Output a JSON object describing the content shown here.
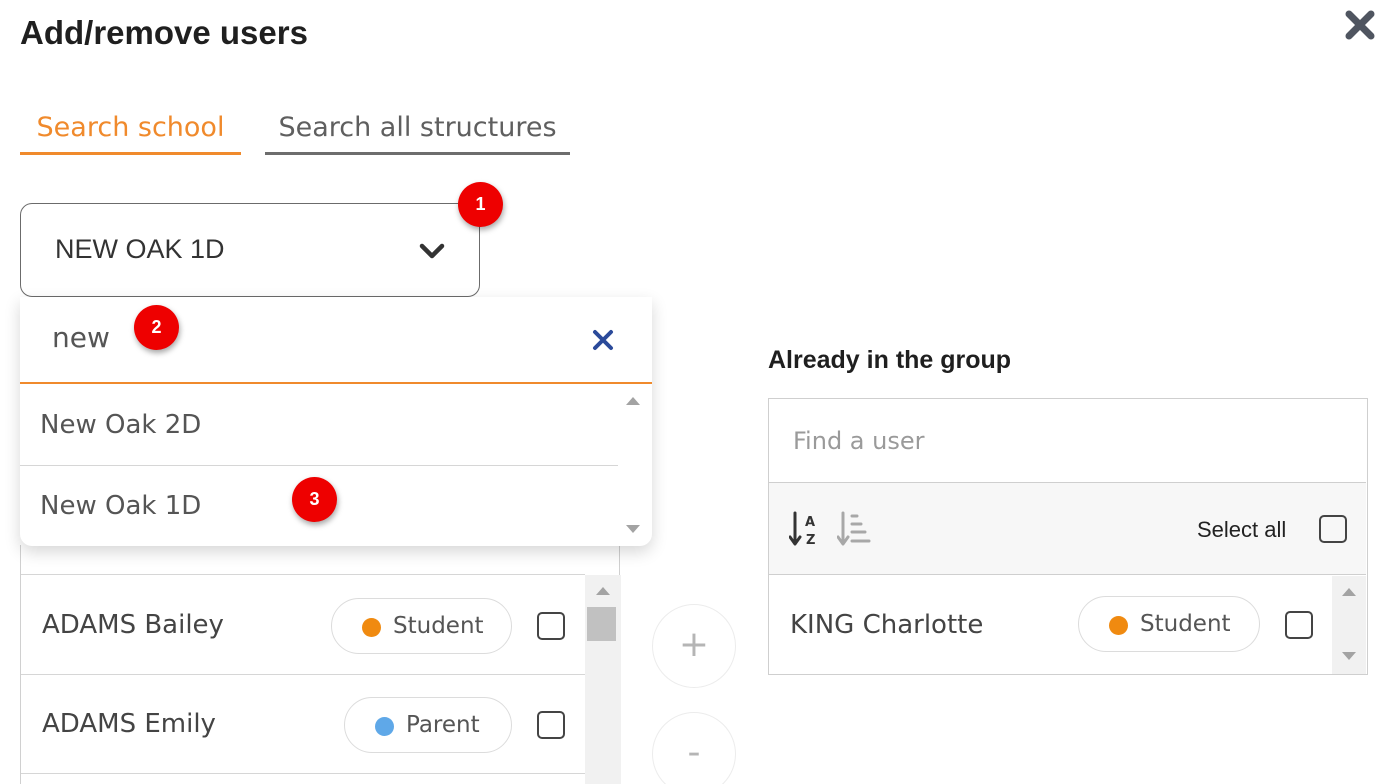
{
  "dialog": {
    "title": "Add/remove users",
    "close_icon": "close-icon"
  },
  "tabs": [
    {
      "label": "Search school",
      "active": true
    },
    {
      "label": "Search all structures",
      "active": false
    }
  ],
  "school_select": {
    "value": "NEW OAK 1D",
    "icon": "chevron-down-icon"
  },
  "dropdown": {
    "search_value": "new",
    "clear_icon": "close-icon",
    "options": [
      "New Oak 2D",
      "New Oak 1D"
    ]
  },
  "badges": [
    "1",
    "2",
    "3"
  ],
  "left_users": [
    {
      "name": "ADAMS Bailey",
      "role": "Student",
      "role_color": "#f08a10"
    },
    {
      "name": "ADAMS Emily",
      "role": "Parent",
      "role_color": "#5fa8e8"
    }
  ],
  "transfer": {
    "add_label": "+",
    "remove_label": "-"
  },
  "group": {
    "heading": "Already in the group",
    "search_placeholder": "Find a user",
    "select_all_label": "Select all",
    "members": [
      {
        "name": "KING Charlotte",
        "role": "Student",
        "role_color": "#f08a10"
      }
    ]
  },
  "colors": {
    "accent": "#f08a2c",
    "badge": "#ee0000",
    "clear": "#2b4a9a"
  }
}
